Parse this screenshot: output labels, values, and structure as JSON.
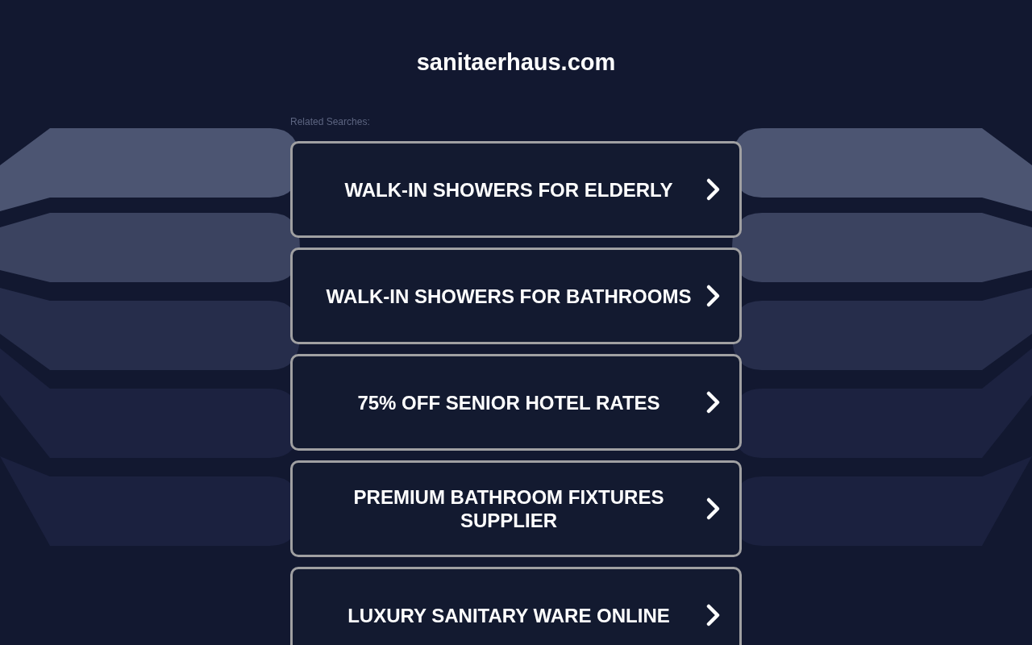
{
  "domain": "sanitaerhaus.com",
  "related_label": "Related Searches:",
  "links": [
    {
      "label": "WALK-IN SHOWERS FOR ELDERLY"
    },
    {
      "label": "WALK-IN SHOWERS FOR BATHROOMS"
    },
    {
      "label": "75% OFF SENIOR HOTEL RATES"
    },
    {
      "label": "PREMIUM BATHROOM FIXTURES SUPPLIER"
    },
    {
      "label": "LUXURY SANITARY WARE ONLINE"
    }
  ]
}
